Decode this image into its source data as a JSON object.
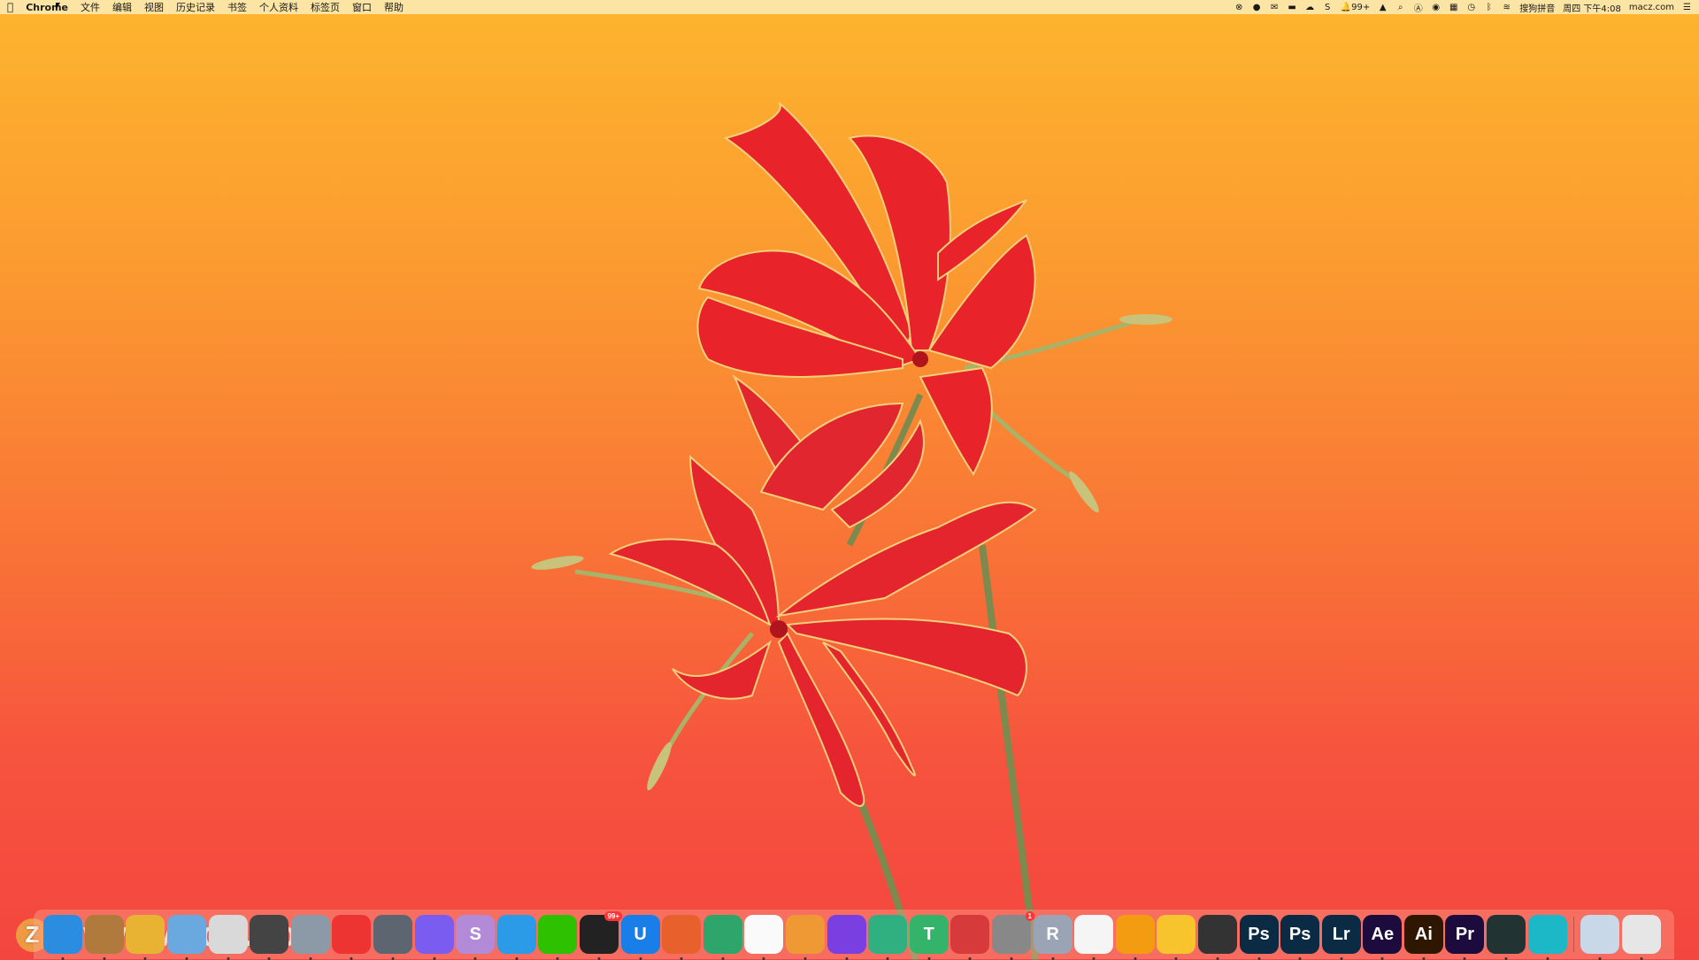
{
  "menubar": {
    "app_name": "Chrome",
    "menus": [
      "文件",
      "编辑",
      "视图",
      "历史记录",
      "书签",
      "个人资料",
      "标签页",
      "窗口",
      "帮助"
    ],
    "status": {
      "notifications": "99+",
      "input_method": "搜狗拼音",
      "datetime": "周四 下午4:08",
      "site": "macz.com"
    }
  },
  "watermark": {
    "text": "www.MacZ.com",
    "logo_letter": "Z"
  },
  "dock": {
    "items": [
      {
        "name": "finder-icon",
        "color": "#2a8de0",
        "label": ""
      },
      {
        "name": "archiver-icon",
        "color": "#b07a3c",
        "label": ""
      },
      {
        "name": "pineapple-icon",
        "color": "#e8b233",
        "label": ""
      },
      {
        "name": "folder-icon",
        "color": "#6aa9e0",
        "label": ""
      },
      {
        "name": "preview-icon",
        "color": "#d9d9d9",
        "label": ""
      },
      {
        "name": "filmstrip-icon",
        "color": "#444",
        "label": ""
      },
      {
        "name": "disk-utility-icon",
        "color": "#8c9aa8",
        "label": ""
      },
      {
        "name": "joystick-icon",
        "color": "#e33",
        "label": ""
      },
      {
        "name": "automator-icon",
        "color": "#5d6670",
        "label": ""
      },
      {
        "name": "downie-icon",
        "color": "#7b5cf0",
        "label": ""
      },
      {
        "name": "scrivener-icon",
        "color": "#b28ad8",
        "label": "S"
      },
      {
        "name": "chat-bubble-icon",
        "color": "#2b9be8",
        "label": ""
      },
      {
        "name": "wechat-icon",
        "color": "#2dc100",
        "label": ""
      },
      {
        "name": "qq-icon",
        "color": "#222",
        "label": "",
        "badge": "99+"
      },
      {
        "name": "utools-icon",
        "color": "#1a7ee8",
        "label": "U"
      },
      {
        "name": "firefox-icon",
        "color": "#e8612c",
        "label": ""
      },
      {
        "name": "edge-canary-icon",
        "color": "#2ea66b",
        "label": ""
      },
      {
        "name": "chrome-icon",
        "color": "#fafafa",
        "label": ""
      },
      {
        "name": "color-wheel-icon",
        "color": "#e93",
        "label": ""
      },
      {
        "name": "microphone-icon",
        "color": "#7a3fe0",
        "label": ""
      },
      {
        "name": "image-viewer-icon",
        "color": "#30b080",
        "label": ""
      },
      {
        "name": "typora-icon",
        "color": "#34b36b",
        "label": "T"
      },
      {
        "name": "magnet-icon",
        "color": "#d63a3a",
        "label": ""
      },
      {
        "name": "system-preferences-icon",
        "color": "#888",
        "label": "",
        "badge": "1"
      },
      {
        "name": "r-icon",
        "color": "#9aa4b5",
        "label": "R"
      },
      {
        "name": "photos-icon",
        "color": "#f5f5f5",
        "label": ""
      },
      {
        "name": "pdf-icon",
        "color": "#f39c12",
        "label": ""
      },
      {
        "name": "sketch-icon",
        "color": "#f7c42e",
        "label": ""
      },
      {
        "name": "final-cut-icon",
        "color": "#333",
        "label": ""
      },
      {
        "name": "photoshop-icon",
        "color": "#0b2a44",
        "label": "Ps"
      },
      {
        "name": "photoshop-icon-2",
        "color": "#0b2a44",
        "label": "Ps"
      },
      {
        "name": "lightroom-icon",
        "color": "#0b2a44",
        "label": "Lr"
      },
      {
        "name": "after-effects-icon",
        "color": "#1e0b3e",
        "label": "Ae"
      },
      {
        "name": "illustrator-icon",
        "color": "#2e1600",
        "label": "Ai"
      },
      {
        "name": "premiere-icon",
        "color": "#1e0b3e",
        "label": "Pr"
      },
      {
        "name": "quicktime-icon",
        "color": "#233",
        "label": ""
      },
      {
        "name": "privacy-eye-icon",
        "color": "#1db8c8",
        "label": ""
      }
    ],
    "trailing": [
      {
        "name": "preview-document-icon",
        "color": "#c8d8e8",
        "label": ""
      },
      {
        "name": "trash-icon",
        "color": "#e6e6e6",
        "label": ""
      }
    ]
  },
  "colors": {
    "flower": "#E8242A",
    "stem": "#8a9a5b"
  }
}
